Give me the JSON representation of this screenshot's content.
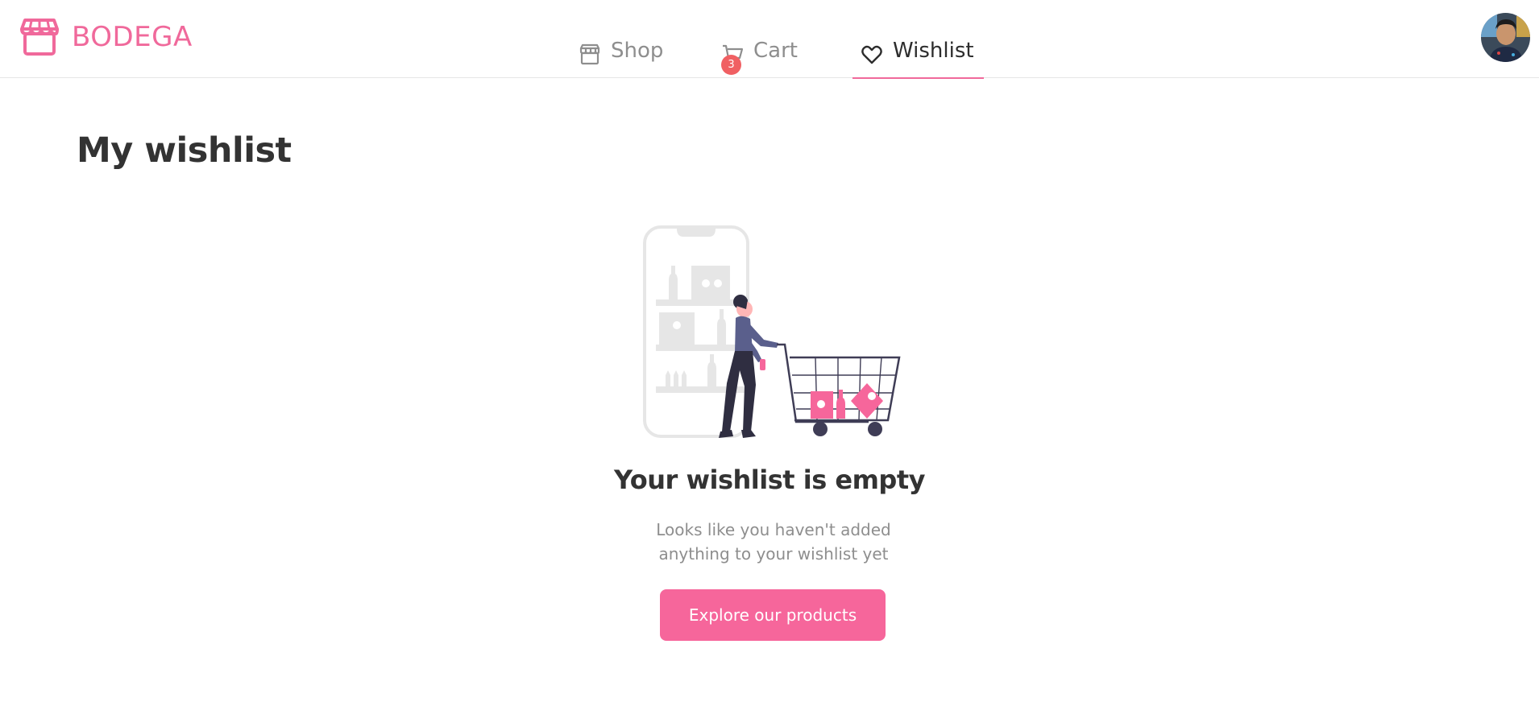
{
  "brand": {
    "name": "BODEGA",
    "icon": "storefront-icon",
    "color": "#f0699b"
  },
  "nav": {
    "shop": {
      "label": "Shop",
      "icon": "store-icon"
    },
    "cart": {
      "label": "Cart",
      "icon": "cart-icon",
      "badge": "3"
    },
    "wishlist": {
      "label": "Wishlist",
      "icon": "heart-icon",
      "active": true
    }
  },
  "user": {
    "avatar": "user-avatar"
  },
  "page": {
    "title": "My wishlist"
  },
  "empty_state": {
    "illustration": "shopping-cart-illustration",
    "title": "Your wishlist is empty",
    "subtitle": "Looks like you haven't added anything to your wishlist yet",
    "button_label": "Explore our products"
  },
  "colors": {
    "accent": "#f6669b",
    "badge": "#f06063",
    "text": "#333333",
    "muted": "#8e8e8e"
  }
}
